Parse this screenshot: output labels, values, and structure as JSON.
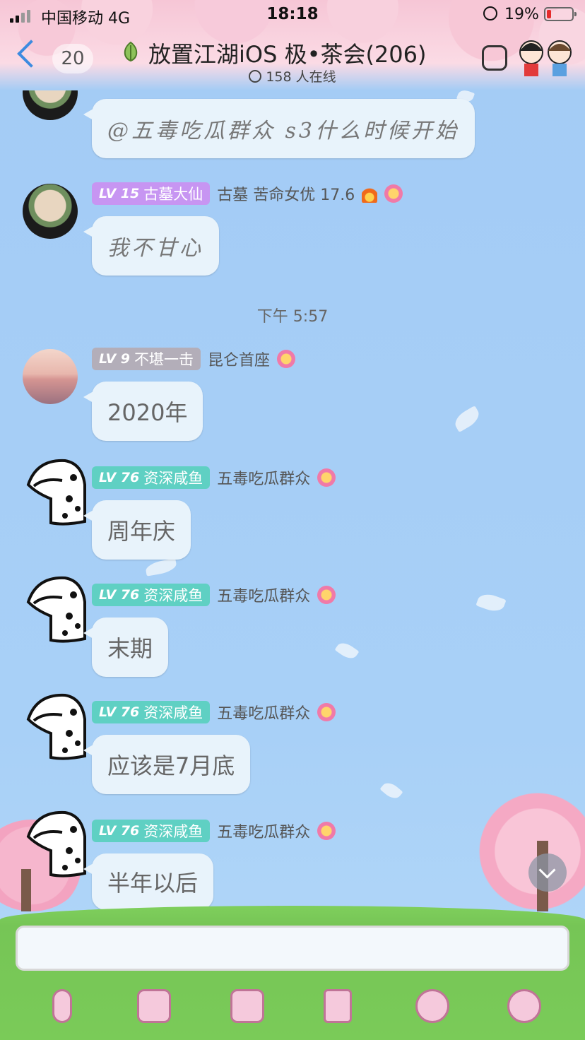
{
  "status": {
    "carrier": "中国移动 4G",
    "time": "18:18",
    "battery": "19%",
    "battery_level": 0.19
  },
  "header": {
    "unread_count": "20",
    "title": "放置江湖iOS 极•茶会(206)",
    "online": "158 人在线"
  },
  "messages": [
    {
      "text": "@五毒吃瓜群众 s3什么时候开始"
    },
    {
      "level": "LV 15",
      "title": "古墓大仙",
      "name": "古墓 苦命女优 17.6",
      "text": "我不甘心"
    },
    {
      "level": "LV 9",
      "title": "不堪一击",
      "name": "昆仑首座",
      "text": "2020年"
    },
    {
      "level": "LV 76",
      "title": "资深咸鱼",
      "name": "五毒吃瓜群众",
      "text": "周年庆"
    },
    {
      "level": "LV 76",
      "title": "资深咸鱼",
      "name": "五毒吃瓜群众",
      "text": "末期"
    },
    {
      "level": "LV 76",
      "title": "资深咸鱼",
      "name": "五毒吃瓜群众",
      "text": "应该是7月底"
    },
    {
      "level": "LV 76",
      "title": "资深咸鱼",
      "name": "五毒吃瓜群众",
      "text": "半年以后"
    }
  ],
  "timestamp": "下午 5:57",
  "input": {
    "value": "",
    "placeholder": ""
  },
  "toolbar": {
    "icons": [
      "microphone-icon",
      "image-icon",
      "camera-icon",
      "red-packet-icon",
      "emoji-icon",
      "plus-icon"
    ]
  }
}
